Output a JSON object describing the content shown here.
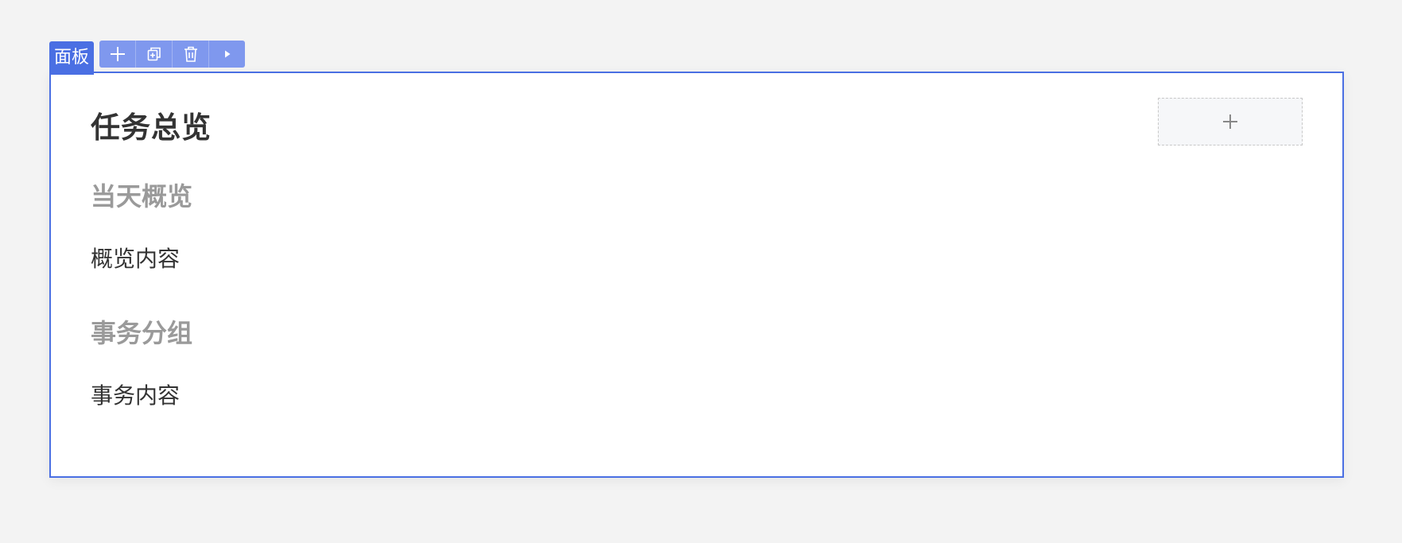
{
  "panel": {
    "tag_label": "面板",
    "title": "任务总览",
    "sections": [
      {
        "heading": "当天概览",
        "content": "概览内容"
      },
      {
        "heading": "事务分组",
        "content": "事务内容"
      }
    ]
  },
  "toolbar": {
    "buttons": [
      {
        "icon": "plus-icon"
      },
      {
        "icon": "copy-icon"
      },
      {
        "icon": "trash-icon"
      },
      {
        "icon": "play-icon"
      }
    ]
  },
  "add_slot": {
    "icon": "plus-icon"
  },
  "colors": {
    "accent": "#4a6fe3",
    "toolbar": "#7f98ee",
    "heading_gray": "#9a9a9a",
    "text": "#333333"
  }
}
